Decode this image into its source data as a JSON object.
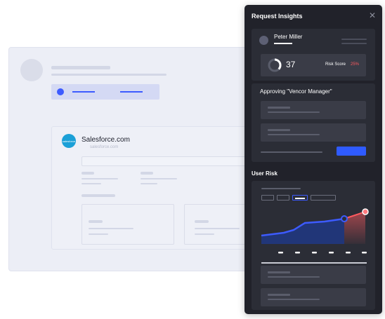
{
  "company": {
    "name": "Salesforce.com",
    "logo_text": "salesforce",
    "ghost_text": "salesforce.com"
  },
  "panel": {
    "title": "Request Insights",
    "close_icon": "close-icon"
  },
  "user": {
    "name": "Peter Miller"
  },
  "score": {
    "value": "37",
    "fraction": 0.37,
    "risk_label": "Risk Score",
    "risk_value": "25%",
    "risk_color": "#ff5a5f"
  },
  "approval": {
    "title": "Approving \"Vencor Manager\""
  },
  "user_risk": {
    "title": "User Risk"
  },
  "colors": {
    "accent": "#2f5bff",
    "panel_bg": "#21222a",
    "danger": "#ff5a5f"
  }
}
